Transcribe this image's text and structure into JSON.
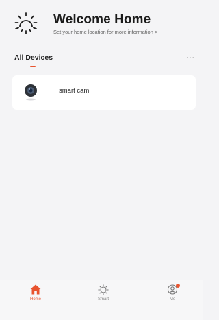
{
  "header": {
    "title": "Welcome Home",
    "subtitle": "Set your home location for more information >",
    "icon": "sun-icon"
  },
  "devices_section": {
    "tab_label": "All Devices",
    "more_icon": "more-icon",
    "more_glyph": "···"
  },
  "devices": [
    {
      "name": "smart cam",
      "icon": "camera-icon"
    }
  ],
  "bottom_nav": {
    "items": [
      {
        "label": "Home",
        "icon": "home-icon",
        "active": true
      },
      {
        "label": "Smart",
        "icon": "smart-icon",
        "active": false
      },
      {
        "label": "Me",
        "icon": "me-icon",
        "active": false,
        "badge": true
      }
    ]
  },
  "colors": {
    "accent": "#e8542f",
    "background": "#f4f4f6",
    "card": "#ffffff"
  }
}
